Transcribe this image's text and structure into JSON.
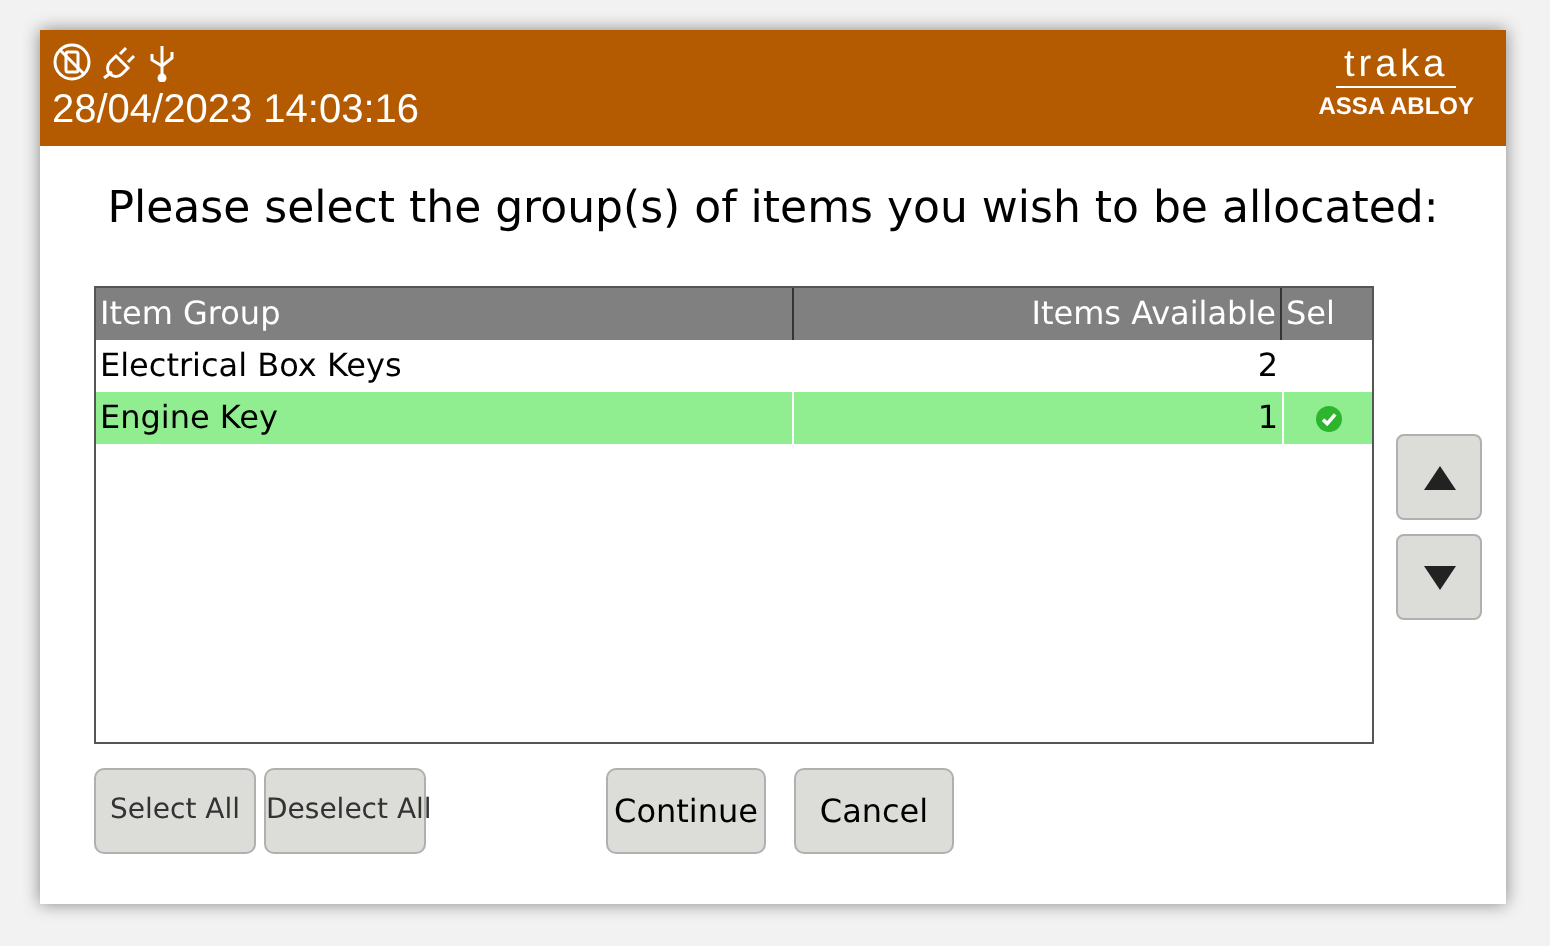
{
  "header": {
    "datetime": "28/04/2023 14:03:16",
    "logo": {
      "brand": "traka",
      "parent": "ASSA ABLOY"
    }
  },
  "prompt": "Please select the group(s) of items you wish to be allocated:",
  "table": {
    "columns": [
      "Item Group",
      "Items Available",
      "Sel"
    ],
    "rows": [
      {
        "item_group": "Electrical Box Keys",
        "items_available": "2",
        "selected": false
      },
      {
        "item_group": "Engine Key",
        "items_available": "1",
        "selected": true
      }
    ]
  },
  "buttons": [
    {
      "label": "Select All",
      "kind": "small"
    },
    {
      "label": "Deselect All",
      "kind": "small"
    },
    {
      "label": "Continue",
      "kind": "large"
    },
    {
      "label": "Cancel",
      "kind": "large"
    }
  ]
}
